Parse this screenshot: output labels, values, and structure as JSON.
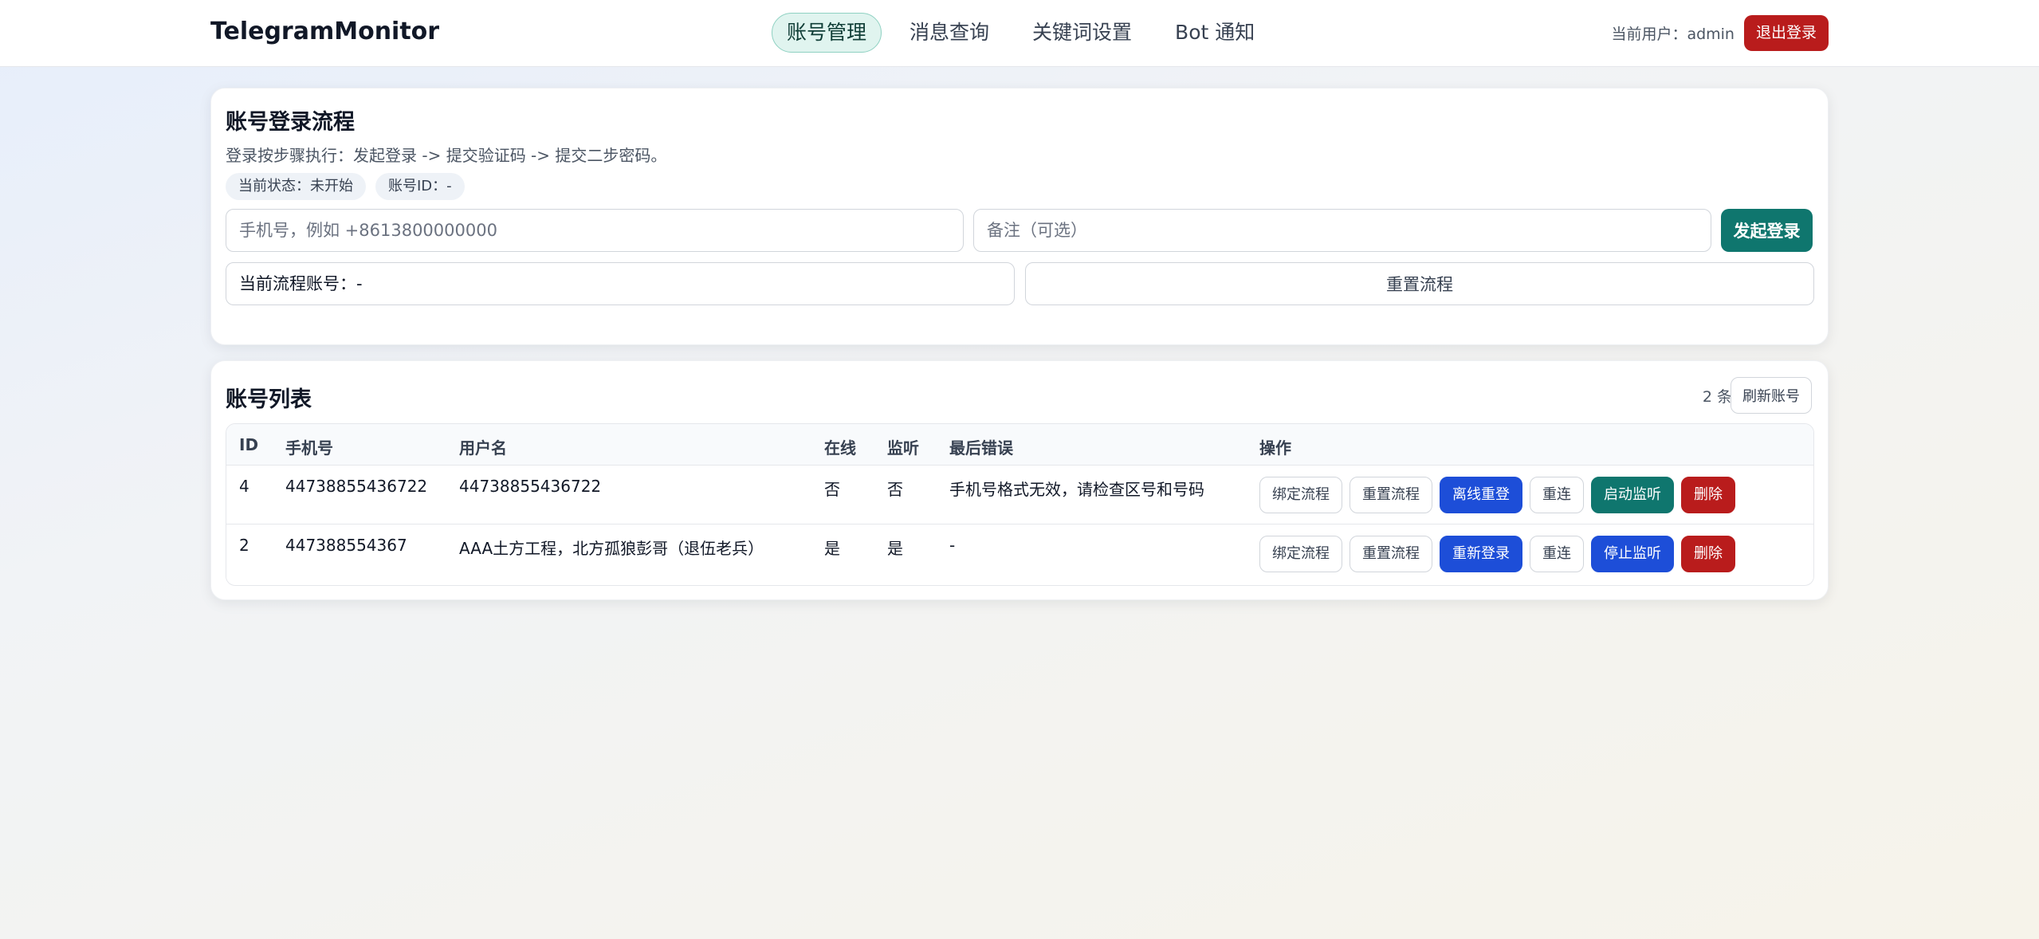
{
  "app": {
    "brand": "TelegramMonitor"
  },
  "nav": {
    "items": [
      {
        "label": "账号管理",
        "active": true
      },
      {
        "label": "消息查询",
        "active": false
      },
      {
        "label": "关键词设置",
        "active": false
      },
      {
        "label": "Bot 通知",
        "active": false
      }
    ]
  },
  "user": {
    "label": "当前用户：admin",
    "logout_label": "退出登录"
  },
  "login_flow": {
    "title": "账号登录流程",
    "description": "登录按步骤执行：发起登录 -> 提交验证码 -> 提交二步密码。",
    "status_pill": "当前状态：未开始",
    "account_id_pill": "账号ID：-",
    "phone_placeholder": "手机号，例如 +8613800000000",
    "note_placeholder": "备注（可选）",
    "start_label": "发起登录",
    "current_account": "当前流程账号：-",
    "reset_label": "重置流程"
  },
  "account_list": {
    "title": "账号列表",
    "count": "2 条",
    "refresh_label": "刷新账号",
    "columns": [
      "ID",
      "手机号",
      "用户名",
      "在线",
      "监听",
      "最后错误",
      "操作"
    ],
    "rows": [
      {
        "id": "4",
        "phone": "44738855436722",
        "username": "44738855436722",
        "online": "否",
        "listening": "否",
        "last_error": "手机号格式无效，请检查区号和号码",
        "actions": {
          "bind": "绑定流程",
          "reset": "重置流程",
          "relogin": "离线重登",
          "reconnect": "重连",
          "listen": "启动监听",
          "delete": "删除"
        }
      },
      {
        "id": "2",
        "phone": "447388554367",
        "username": "AAA土方工程，北方孤狼彭哥（退伍老兵）",
        "online": "是",
        "listening": "是",
        "last_error": "-",
        "actions": {
          "bind": "绑定流程",
          "reset": "重置流程",
          "relogin": "重新登录",
          "reconnect": "重连",
          "listen": "停止监听",
          "delete": "删除"
        }
      }
    ]
  },
  "colors": {
    "accent_green": "#0f766e",
    "accent_blue": "#1d4ed8",
    "danger_red": "#b91c1c",
    "active_tab_bg": "#e0f4ef"
  }
}
